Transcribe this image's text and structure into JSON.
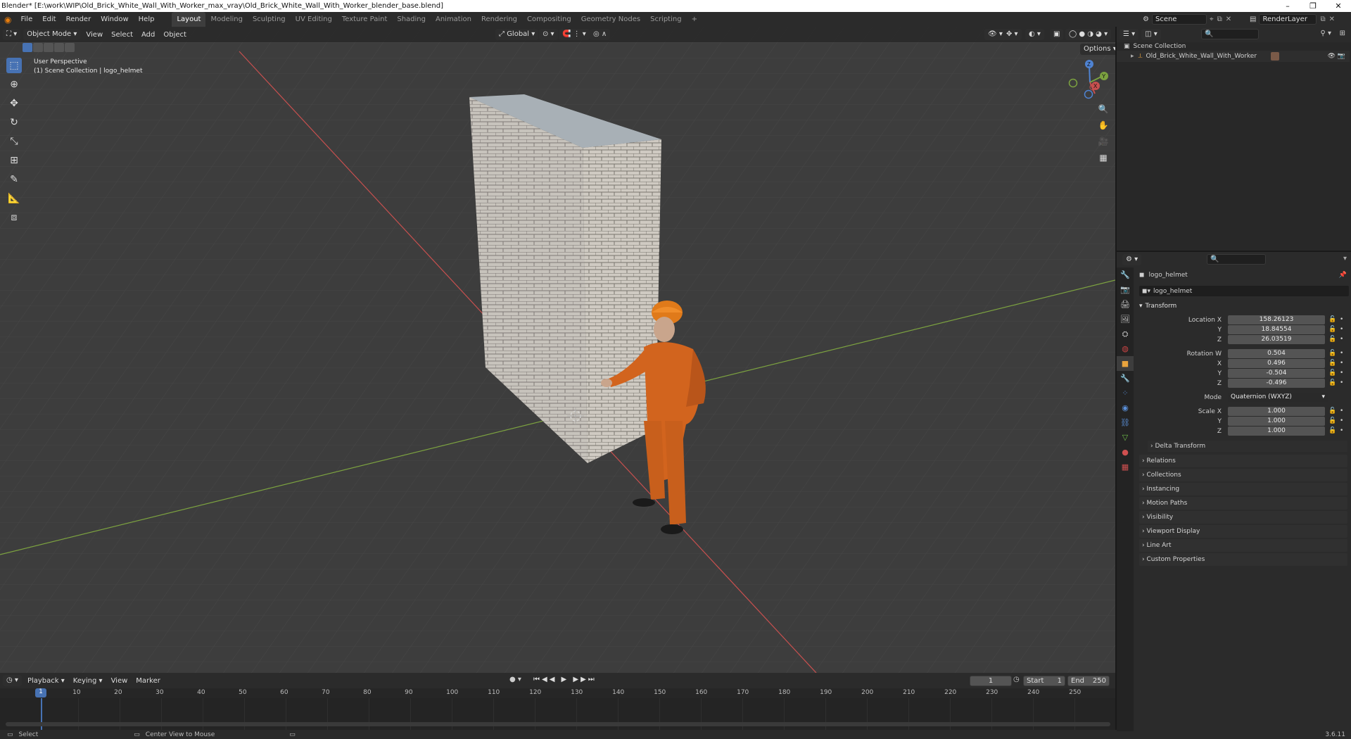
{
  "window": {
    "title": "Blender* [E:\\work\\WIP\\Old_Brick_White_Wall_With_Worker_max_vray\\Old_Brick_White_Wall_With_Worker_blender_base.blend]",
    "minimize": "–",
    "maximize": "❐",
    "close": "✕"
  },
  "menu": [
    "File",
    "Edit",
    "Render",
    "Window",
    "Help"
  ],
  "workspaces": [
    "Layout",
    "Modeling",
    "Sculpting",
    "UV Editing",
    "Texture Paint",
    "Shading",
    "Animation",
    "Rendering",
    "Compositing",
    "Geometry Nodes",
    "Scripting"
  ],
  "add_workspace": "+",
  "scene": {
    "label": "Scene",
    "render_layer": "RenderLayer"
  },
  "viewport": {
    "mode": "Object Mode",
    "menus": [
      "View",
      "Select",
      "Add",
      "Object"
    ],
    "orientation": "Global",
    "options": "Options",
    "perspective": "User Perspective",
    "collection_info": "(1) Scene Collection | logo_helmet",
    "axis_labels": {
      "x": "X",
      "y": "Y",
      "z": "Z"
    }
  },
  "outliner": {
    "root": "Scene Collection",
    "item": "Old_Brick_White_Wall_With_Worker"
  },
  "properties": {
    "object_name": "logo_helmet",
    "data_name": "logo_helmet",
    "transform_label": "Transform",
    "location": {
      "x_label": "Location X",
      "y_label": "Y",
      "z_label": "Z",
      "x": "158.26123",
      "y": "18.84554",
      "z": "26.03519"
    },
    "rotation": {
      "w_label": "Rotation W",
      "x_label": "X",
      "y_label": "Y",
      "z_label": "Z",
      "w": "0.504",
      "x": "0.496",
      "y": "-0.504",
      "z": "-0.496"
    },
    "mode_label": "Mode",
    "mode_value": "Quaternion (WXYZ)",
    "scale": {
      "x_label": "Scale X",
      "y_label": "Y",
      "z_label": "Z",
      "x": "1.000",
      "y": "1.000",
      "z": "1.000"
    },
    "delta_transform": "Delta Transform",
    "panels": [
      "Relations",
      "Collections",
      "Instancing",
      "Motion Paths",
      "Visibility",
      "Viewport Display",
      "Line Art",
      "Custom Properties"
    ]
  },
  "timeline": {
    "menus": [
      "Playback",
      "Keying",
      "View",
      "Marker"
    ],
    "current_frame": "1",
    "start_label": "Start",
    "start": "1",
    "end_label": "End",
    "end": "250",
    "ticks": [
      "10",
      "20",
      "30",
      "40",
      "50",
      "60",
      "70",
      "80",
      "90",
      "100",
      "110",
      "120",
      "130",
      "140",
      "150",
      "160",
      "170",
      "180",
      "190",
      "200",
      "210",
      "220",
      "230",
      "240",
      "250"
    ],
    "playhead": "1"
  },
  "status": {
    "select": "Select",
    "center": "Center View to Mouse",
    "version": "3.6.11"
  },
  "colors": {
    "accent": "#4772b3",
    "x_axis": "#c8504f",
    "y_axis": "#7ca240",
    "z_axis": "#4f83d2",
    "suit": "#d2641e"
  }
}
